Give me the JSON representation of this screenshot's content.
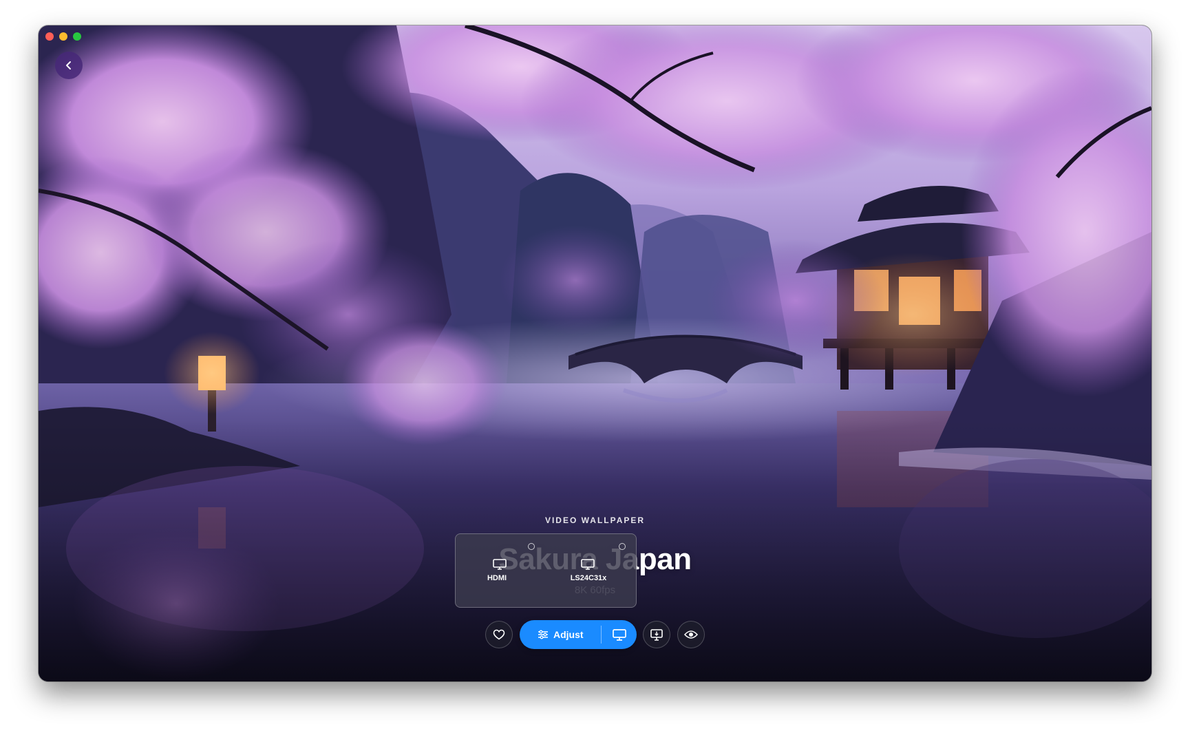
{
  "wallpaper": {
    "category": "VIDEO WALLPAPER",
    "title": "Sakura Japan",
    "subtitle": "8K 60fps",
    "image": "night-cherry-blossom-lake-with-bridge-and-pavilion"
  },
  "window": {
    "controls": [
      "close",
      "minimize",
      "maximize"
    ],
    "back_icon": "chevron-left-icon"
  },
  "display_selector": {
    "displays": [
      {
        "label": "HDMI",
        "icon": "monitor-icon",
        "selected": false
      },
      {
        "label": "LS24C31x",
        "icon": "monitor-icon",
        "selected": false
      }
    ]
  },
  "toolbar": {
    "favorite_icon": "heart-icon",
    "adjust_label": "Adjust",
    "adjust_icon": "sliders-icon",
    "display_icon": "monitor-icon",
    "set_desktop_icon": "monitor-download-icon",
    "preview_icon": "eye-icon"
  },
  "colors": {
    "accent": "#1a8bff",
    "back_button": "#46287a",
    "traffic_close": "#ff5f57",
    "traffic_minimize": "#febc2e",
    "traffic_maximize": "#28c840"
  }
}
